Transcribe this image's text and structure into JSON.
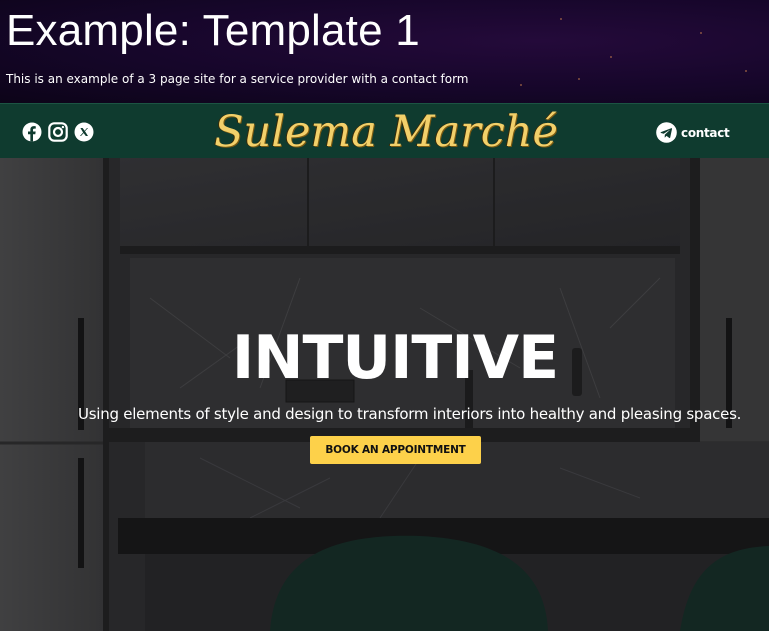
{
  "banner": {
    "title": "Example: Template 1",
    "subtitle": "This is an example of a 3 page site for a service provider with a contact form"
  },
  "navbar": {
    "brand": "Sulema Marché",
    "social_icons": [
      "facebook-icon",
      "instagram-icon",
      "x-icon"
    ],
    "contact_label": "contact",
    "contact_icon": "telegram-icon"
  },
  "hero": {
    "title": "INTUITIVE",
    "subtitle": "Using elements of style and design to transform interiors into healthy and pleasing spaces.",
    "cta_label": "BOOK AN APPOINTMENT"
  },
  "colors": {
    "banner_bg": "#16062a",
    "navbar_bg": "#0f3b2f",
    "brand_gold": "#f2d06a",
    "cta_yellow": "#fdd14a"
  }
}
